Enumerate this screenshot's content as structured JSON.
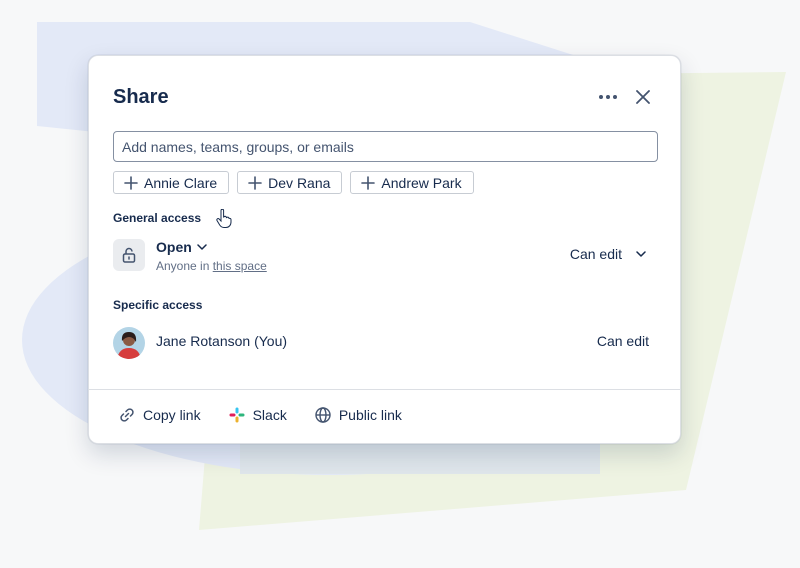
{
  "dialog": {
    "title": "Share",
    "more_icon": "more-horizontal-icon",
    "close_icon": "close-icon"
  },
  "search": {
    "placeholder": "Add names, teams, groups, or emails",
    "value": ""
  },
  "suggestions": [
    {
      "label": "Annie Clare",
      "icon": "plus-icon"
    },
    {
      "label": "Dev Rana",
      "icon": "plus-icon"
    },
    {
      "label": "Andrew Park",
      "icon": "plus-icon"
    }
  ],
  "general_access": {
    "heading": "General access",
    "level": "Open",
    "description_prefix": "Anyone in ",
    "description_link": "this space",
    "permission": "Can edit",
    "icon": "unlock-icon"
  },
  "specific_access": {
    "heading": "Specific access",
    "users": [
      {
        "name": "Jane Rotanson (You)",
        "permission": "Can edit"
      }
    ]
  },
  "footer": {
    "copy_link": "Copy link",
    "slack": "Slack",
    "public_link": "Public link"
  },
  "colors": {
    "text": "#172b4d",
    "subtle_text": "#626f86",
    "border": "#dcdfe4",
    "bg_blue": "#e3e9f7",
    "bg_green": "#eef3e3"
  }
}
